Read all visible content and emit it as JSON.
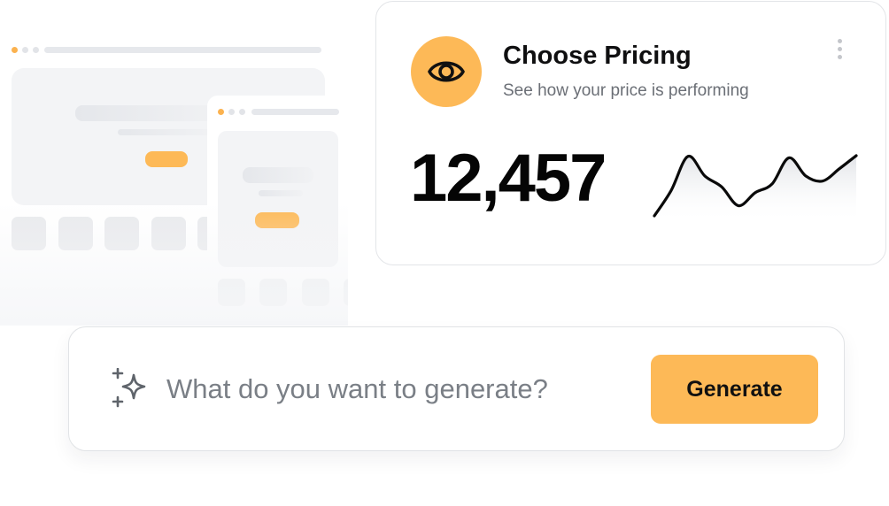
{
  "colors": {
    "accent": "#fdb957",
    "text_primary": "#0f0f10",
    "text_secondary": "#6b6f76",
    "border": "#e3e5e8"
  },
  "pricing_card": {
    "icon": "eye-icon",
    "title": "Choose Pricing",
    "subtitle": "See how your price is performing",
    "value": "12,457",
    "menu_icon": "kebab-menu-icon"
  },
  "chart_data": {
    "type": "line",
    "title": "",
    "xlabel": "",
    "ylabel": "",
    "grid": false,
    "legend": "none",
    "ylim": [
      0,
      100
    ],
    "x": [
      0,
      1,
      2,
      3,
      4,
      5,
      6,
      7,
      8,
      9,
      10,
      11,
      12
    ],
    "series": [
      {
        "values": [
          0,
          35,
          82,
          55,
          40,
          14,
          32,
          44,
          80,
          55,
          48,
          65,
          83
        ]
      }
    ]
  },
  "prompt": {
    "icon": "sparkle-icon",
    "placeholder": "What do you want to generate?",
    "button_label": "Generate"
  }
}
